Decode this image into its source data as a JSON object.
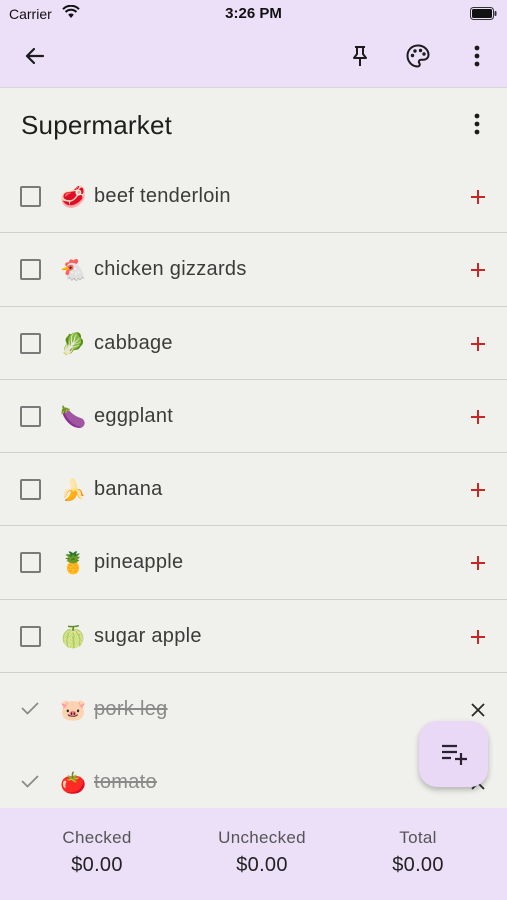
{
  "status_bar": {
    "carrier": "Carrier",
    "time": "3:26 PM"
  },
  "app_bar": {
    "icons": [
      "back-arrow-icon",
      "pin-icon",
      "palette-icon",
      "more-vert-icon"
    ]
  },
  "list": {
    "title": "Supermarket"
  },
  "items": [
    {
      "emoji": "🥩",
      "name": "beef tenderloin",
      "checked": false
    },
    {
      "emoji": "🐔",
      "name": "chicken gizzards",
      "checked": false
    },
    {
      "emoji": "🥬",
      "name": "cabbage",
      "checked": false
    },
    {
      "emoji": "🍆",
      "name": "eggplant",
      "checked": false
    },
    {
      "emoji": "🍌",
      "name": "banana",
      "checked": false
    },
    {
      "emoji": "🍍",
      "name": "pineapple",
      "checked": false
    },
    {
      "emoji": "🍈",
      "name": "sugar apple",
      "checked": false
    },
    {
      "emoji": "🐷",
      "name": "pork leg",
      "checked": true
    },
    {
      "emoji": "🍅",
      "name": "tomato",
      "checked": true
    }
  ],
  "summary": {
    "checked_label": "Checked",
    "checked_value": "$0.00",
    "unchecked_label": "Unchecked",
    "unchecked_value": "$0.00",
    "total_label": "Total",
    "total_value": "$0.00"
  },
  "colors": {
    "bar": "#ecdff8",
    "background": "#f0f0ec",
    "add_accent": "#c62828",
    "fab": "#ead8f7"
  }
}
